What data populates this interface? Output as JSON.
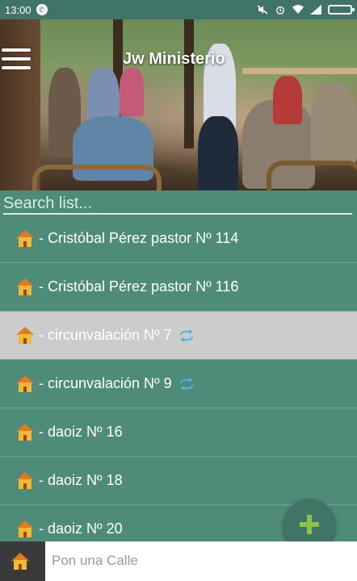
{
  "status_bar": {
    "time": "13:00",
    "left_icons": [
      "whatsapp-icon"
    ],
    "right_icons": [
      "mute-icon",
      "alarm-icon",
      "wifi-icon",
      "signal-icon",
      "battery-icon"
    ]
  },
  "header": {
    "title": "Jw Ministerio",
    "menu_icon": "hamburger-menu-icon"
  },
  "search": {
    "placeholder": "Search list..."
  },
  "list": {
    "items": [
      {
        "label": "- Cristóbal Pérez pastor  Nº 114",
        "icon": "house-icon",
        "synced": false,
        "selected": false
      },
      {
        "label": "- Cristóbal Pérez pastor  Nº 116",
        "icon": "house-icon",
        "synced": false,
        "selected": false
      },
      {
        "label": "- circunvalación  Nº 7",
        "icon": "house-icon",
        "synced": true,
        "selected": true
      },
      {
        "label": "- circunvalación  Nº 9",
        "icon": "house-icon",
        "synced": true,
        "selected": false
      },
      {
        "label": "- daoiz  Nº 16",
        "icon": "house-icon",
        "synced": false,
        "selected": false
      },
      {
        "label": "- daoiz  Nº 18",
        "icon": "house-icon",
        "synced": false,
        "selected": false
      },
      {
        "label": "- daoiz  Nº 20",
        "icon": "house-icon",
        "synced": false,
        "selected": false
      }
    ]
  },
  "fab": {
    "icon": "plus-icon",
    "color": "#8bc34a"
  },
  "bottom_input": {
    "placeholder": "Pon una Calle",
    "icon": "house-icon"
  },
  "colors": {
    "primary": "#4e8b78",
    "selected_row": "#cccccc",
    "accent": "#8bc34a",
    "sync_icon": "#4fb3e8"
  }
}
